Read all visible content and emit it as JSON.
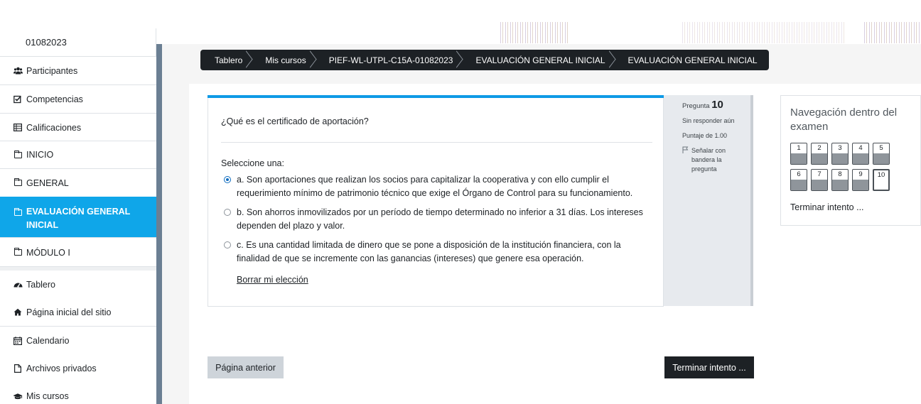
{
  "sidebar": {
    "cut_label": "01082023",
    "items": [
      {
        "label": "Participantes",
        "icon": "users-icon"
      },
      {
        "label": "Competencias",
        "icon": "checkbox-icon"
      },
      {
        "label": "Calificaciones",
        "icon": "table-icon"
      },
      {
        "label": "INICIO",
        "icon": "folder-icon"
      },
      {
        "label": "GENERAL",
        "icon": "folder-icon"
      },
      {
        "label": "EVALUACIÓN GENERAL INICIAL",
        "icon": "folder-icon"
      },
      {
        "label": "MÓDULO I",
        "icon": "folder-icon"
      },
      {
        "label": "Tablero",
        "icon": "dashboard-icon"
      },
      {
        "label": "Página inicial del sitio",
        "icon": "home-icon"
      },
      {
        "label": "Calendario",
        "icon": "calendar-icon"
      },
      {
        "label": "Archivos privados",
        "icon": "file-icon"
      },
      {
        "label": "Mis cursos",
        "icon": "graduation-cap-icon"
      }
    ]
  },
  "breadcrumb": [
    "Tablero",
    "Mis cursos",
    "PIEF-WL-UTPL-C15A-01082023",
    "EVALUACIÓN GENERAL INICIAL",
    "EVALUACIÓN GENERAL INICIAL"
  ],
  "question": {
    "label": "Pregunta",
    "number": "10",
    "status": "Sin responder aún",
    "score": "Puntaje de 1.00",
    "flag": "Señalar con bandera la pregunta",
    "text": "¿Qué es el certificado de aportación?",
    "select_prompt": "Seleccione una:",
    "options": [
      "a. Son aportaciones que realizan los socios para capitalizar la cooperativa y con ello cumplir el requerimiento mínimo de patrimonio técnico que exige el Órgano de Control para su funcionamiento.",
      "b. Son ahorros inmovilizados por un período de tiempo determinado no inferior a 31 días. Los intereses dependen del plazo y valor.",
      "c. Es una cantidad limitada de dinero que se pone a disposición de la institución financiera, con la finalidad de que se incremente con las ganancias (intereses) que genere esa operación."
    ],
    "selected_option": 0,
    "clear_label": "Borrar mi elección"
  },
  "quiz_nav": {
    "title": "Navegación dentro del examen",
    "buttons": [
      "1",
      "2",
      "3",
      "4",
      "5",
      "6",
      "7",
      "8",
      "9",
      "10"
    ],
    "current": "10",
    "finish_label": "Terminar intento ..."
  },
  "footer": {
    "prev_label": "Página anterior",
    "finish_label": "Terminar intento ..."
  },
  "colors": {
    "accent": "#0fa6e9",
    "dark": "#1d2125",
    "progress_bar": "#0f9ae6"
  }
}
